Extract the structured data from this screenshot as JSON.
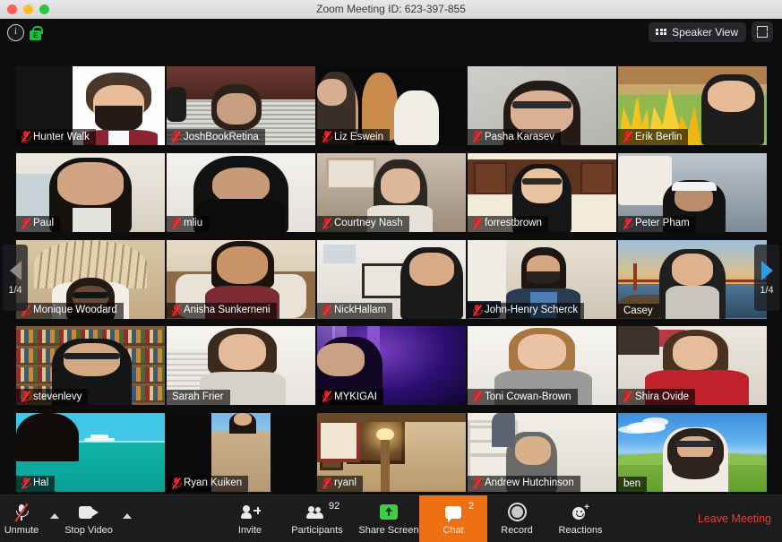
{
  "window": {
    "title": "Zoom Meeting ID: 623-397-855",
    "traffic_lights": [
      "close",
      "minimize",
      "zoom"
    ]
  },
  "topbar": {
    "info_icon": "info-icon",
    "lock_icon": "lock-icon",
    "lock_letter": "E",
    "view_button_label": "Speaker View",
    "view_icon": "grid-icon",
    "fullscreen_icon": "fullscreen-icon"
  },
  "pagination": {
    "left_label": "1/4",
    "right_label": "1/4",
    "left_icon": "chevron-left-icon",
    "right_icon": "chevron-right-icon"
  },
  "grid": {
    "columns": 5,
    "rows": 5,
    "participants": [
      {
        "name": "Hunter Walk",
        "muted": true,
        "active": false,
        "scene": "avatar-illustration"
      },
      {
        "name": "JoshBookRetina",
        "muted": true,
        "active": false,
        "scene": "blinds-window"
      },
      {
        "name": "Liz Eswein",
        "muted": true,
        "active": false,
        "scene": "dogs-dark"
      },
      {
        "name": "Pasha Karasev",
        "muted": true,
        "active": false,
        "scene": "plain-gray-wall"
      },
      {
        "name": "Erik Berlin",
        "muted": true,
        "active": false,
        "scene": "this-is-fine-flames"
      },
      {
        "name": "Paul",
        "muted": true,
        "active": false,
        "scene": "bright-room"
      },
      {
        "name": "mliu",
        "muted": true,
        "active": false,
        "scene": "hoodie-white-room"
      },
      {
        "name": "Courtney Nash",
        "muted": true,
        "active": false,
        "scene": "home-interior"
      },
      {
        "name": "forrestbrown",
        "muted": true,
        "active": false,
        "scene": "kitchen-cabinets"
      },
      {
        "name": "Peter Pham",
        "muted": true,
        "active": false,
        "scene": "liquid-death-poster"
      },
      {
        "name": "Monique Woodard",
        "muted": true,
        "active": false,
        "scene": "rattan-headboard"
      },
      {
        "name": "Anisha Sunkerneni",
        "muted": true,
        "active": false,
        "scene": "bedroom-wood"
      },
      {
        "name": "NickHallam",
        "muted": true,
        "active": false,
        "scene": "white-wall-frames"
      },
      {
        "name": "John-Henry Scherck",
        "muted": true,
        "active": false,
        "scene": "living-room-bike"
      },
      {
        "name": "Casey",
        "muted": false,
        "active": false,
        "scene": "golden-gate-sunset"
      },
      {
        "name": "stevenlevy",
        "muted": true,
        "active": false,
        "scene": "bookshelves"
      },
      {
        "name": "Sarah Frier",
        "muted": false,
        "active": false,
        "scene": "white-blinds"
      },
      {
        "name": "MYKIGAI",
        "muted": true,
        "active": false,
        "scene": "purple-stage-lights"
      },
      {
        "name": "Toni Cowan-Brown",
        "muted": true,
        "active": false,
        "scene": "white-wall-plain"
      },
      {
        "name": "Shira Ovide",
        "muted": true,
        "active": false,
        "scene": "red-top-poster"
      },
      {
        "name": "Hal",
        "muted": true,
        "active": false,
        "scene": "cruise-ship-ocean"
      },
      {
        "name": "Ryan Kuiken",
        "muted": true,
        "active": false,
        "scene": "desert-sky"
      },
      {
        "name": "ryanl",
        "muted": true,
        "active": false,
        "scene": "warm-lamp-frames"
      },
      {
        "name": "Andrew Hutchinson",
        "muted": true,
        "active": false,
        "scene": "white-shelves-room"
      },
      {
        "name": "ben",
        "muted": false,
        "active": true,
        "scene": "windows-xp-bliss"
      }
    ]
  },
  "toolbar": {
    "items": [
      {
        "id": "unmute",
        "label": "Unmute",
        "icon": "microphone-muted-icon",
        "caret": true,
        "badge": null,
        "highlight": false
      },
      {
        "id": "stop-video",
        "label": "Stop Video",
        "icon": "camera-icon",
        "caret": true,
        "badge": null,
        "highlight": false
      },
      {
        "id": "invite",
        "label": "Invite",
        "icon": "person-add-icon",
        "caret": false,
        "badge": null,
        "highlight": false
      },
      {
        "id": "participants",
        "label": "Participants",
        "icon": "people-icon",
        "caret": false,
        "badge": "92",
        "highlight": false
      },
      {
        "id": "share-screen",
        "label": "Share Screen",
        "icon": "share-screen-icon",
        "caret": false,
        "badge": null,
        "highlight": false
      },
      {
        "id": "chat",
        "label": "Chat",
        "icon": "chat-bubble-icon",
        "caret": false,
        "badge": "2",
        "highlight": true
      },
      {
        "id": "record",
        "label": "Record",
        "icon": "record-icon",
        "caret": false,
        "badge": null,
        "highlight": false
      },
      {
        "id": "reactions",
        "label": "Reactions",
        "icon": "reactions-icon",
        "caret": false,
        "badge": null,
        "highlight": false
      }
    ],
    "leave_label": "Leave Meeting"
  },
  "colors": {
    "accent_orange": "#ef7013",
    "leave_red": "#e0403a",
    "mute_red": "#e02020",
    "active_border": "#cddc6b",
    "share_green": "#3ecb45",
    "lock_green": "#19c13c",
    "arrow_blue": "#2f9de0",
    "toolbar_bg": "#1c1c1c",
    "app_bg": "#0d0d0d"
  }
}
